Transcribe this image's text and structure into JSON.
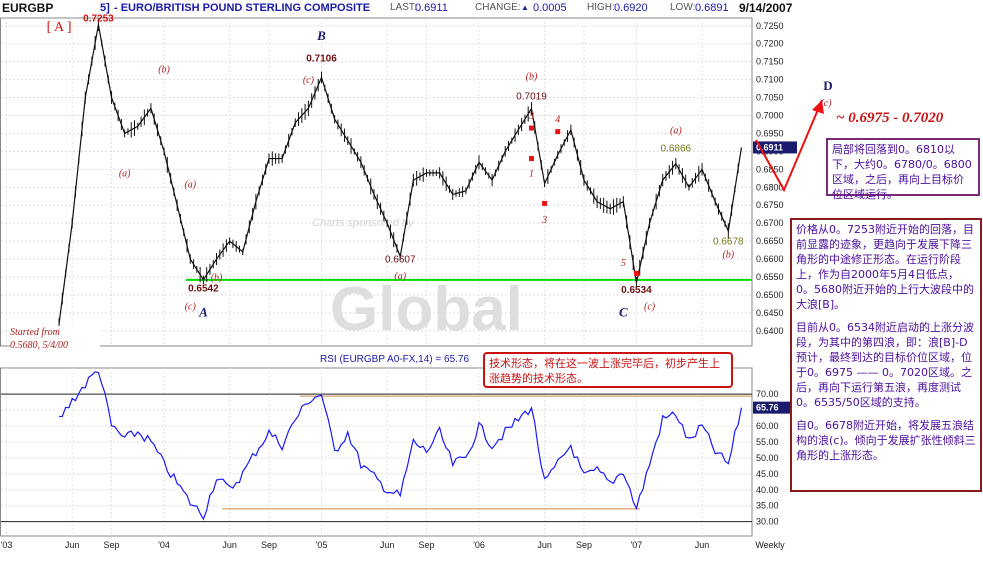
{
  "header": {
    "symbol": "EURGBP",
    "period_hint": "5]",
    "title": "- EURO/BRITISH POUND STERLING COMPOSITE",
    "last_label": "LAST:",
    "last_value": "0.6911",
    "change_label": "CHANGE:",
    "change_value": "0.0005",
    "high_label": "HIGH:",
    "high_value": "0.6920",
    "low_label": "LOW:",
    "low_value": "0.6891",
    "date": "9/14/2007"
  },
  "colors": {
    "price": "#111111",
    "support": "#00dd00",
    "rsi": "#1a1aff",
    "wave_label": "#b22222",
    "wave_letter": "#1a1a6e",
    "header_blue": "#1a1aaa",
    "last_marker": "#1a1a6e",
    "annotation": "#4b0d9e"
  },
  "chart_data": [
    {
      "type": "line",
      "name": "price",
      "x": [
        "2003-05",
        "2003-06",
        "2003-07",
        "2003-08",
        "2003-09",
        "2003-10",
        "2003-11",
        "2003-12",
        "2004-01",
        "2004-02",
        "2004-03",
        "2004-04",
        "2004-05",
        "2004-06",
        "2004-07",
        "2004-08",
        "2004-09",
        "2004-10",
        "2004-11",
        "2004-12",
        "2005-01",
        "2005-02",
        "2005-03",
        "2005-04",
        "2005-05",
        "2005-06",
        "2005-07",
        "2005-08",
        "2005-09",
        "2005-10",
        "2005-11",
        "2005-12",
        "2006-01",
        "2006-02",
        "2006-03",
        "2006-04",
        "2006-05",
        "2006-06",
        "2006-07",
        "2006-08",
        "2006-09",
        "2006-10",
        "2006-11",
        "2006-12",
        "2007-01",
        "2007-02",
        "2007-03",
        "2007-04",
        "2007-05",
        "2007-06",
        "2007-07",
        "2007-08",
        "2007-09"
      ],
      "y": [
        0.642,
        0.67,
        0.705,
        0.7253,
        0.705,
        0.695,
        0.697,
        0.702,
        0.69,
        0.675,
        0.66,
        0.6542,
        0.66,
        0.665,
        0.662,
        0.676,
        0.688,
        0.688,
        0.698,
        0.702,
        0.7106,
        0.699,
        0.693,
        0.687,
        0.678,
        0.67,
        0.6607,
        0.682,
        0.684,
        0.684,
        0.678,
        0.679,
        0.687,
        0.682,
        0.69,
        0.696,
        0.7019,
        0.681,
        0.689,
        0.696,
        0.682,
        0.676,
        0.674,
        0.676,
        0.6534,
        0.67,
        0.682,
        0.6866,
        0.68,
        0.685,
        0.676,
        0.6678,
        0.6911
      ],
      "tick_labels_x": [
        "'03",
        "Jun",
        "Sep",
        "'04",
        "Jun",
        "Sep",
        "'05",
        "Jun",
        "Sep",
        "'06",
        "Jun",
        "Sep",
        "'07",
        "Jun",
        "Weekly"
      ],
      "tick_labels_y": [
        "0.7250",
        "0.7200",
        "0.7150",
        "0.7100",
        "0.7050",
        "0.7000",
        "0.6950",
        "0.6900",
        "0.6850",
        "0.6800",
        "0.6750",
        "0.6700",
        "0.6650",
        "0.6600",
        "0.6550",
        "0.6500",
        "0.6450",
        "0.6400"
      ],
      "ylim": [
        0.638,
        0.728
      ],
      "support_level": 0.6542,
      "last_value": "0.6911",
      "watermark_text": "Charts sponsored by",
      "watermark_brand": "Global",
      "wave_labels": [
        {
          "text": "[ A ]",
          "date": "2003-05",
          "value": 0.7235
        },
        {
          "text": "0.7253",
          "date": "2003-08",
          "value": 0.7262
        },
        {
          "text": "(b)",
          "date": "2004-01",
          "value": 0.712
        },
        {
          "text": "(a)",
          "date": "2003-10",
          "value": 0.683
        },
        {
          "text": "(a)",
          "date": "2004-03",
          "value": 0.68
        },
        {
          "text": "(b)",
          "date": "2004-05",
          "value": 0.654
        },
        {
          "text": "0.6542",
          "date": "2004-04",
          "value": 0.651
        },
        {
          "text": "(c)",
          "date": "2004-03",
          "value": 0.646
        },
        {
          "text": "A",
          "date": "2004-04",
          "value": 0.644
        },
        {
          "text": "B",
          "date": "2005-01",
          "value": 0.721
        },
        {
          "text": "0.7106",
          "date": "2005-01",
          "value": 0.715
        },
        {
          "text": "(c)",
          "date": "2004-12",
          "value": 0.709
        },
        {
          "text": "0.6607",
          "date": "2005-07",
          "value": 0.659
        },
        {
          "text": "(a)",
          "date": "2005-07",
          "value": 0.6545
        },
        {
          "text": "(b)",
          "date": "2006-05",
          "value": 0.71
        },
        {
          "text": "0.7019",
          "date": "2006-05",
          "value": 0.7045
        },
        {
          "text": "3",
          "date": "2006-05",
          "value": 0.699
        },
        {
          "text": "4",
          "date": "2006-07",
          "value": 0.698
        },
        {
          "text": "1",
          "date": "2006-05",
          "value": 0.683
        },
        {
          "text": "3",
          "date": "2006-06",
          "value": 0.67
        },
        {
          "text": "5",
          "date": "2006-12",
          "value": 0.658
        },
        {
          "text": "0.6534",
          "date": "2007-01",
          "value": 0.6505
        },
        {
          "text": "(c)",
          "date": "2007-02",
          "value": 0.646
        },
        {
          "text": "C",
          "date": "2006-12",
          "value": 0.644
        },
        {
          "text": "(a)",
          "date": "2007-04",
          "value": 0.695
        },
        {
          "text": "0.6866",
          "date": "2007-04",
          "value": 0.69
        },
        {
          "text": "0.6678",
          "date": "2007-08",
          "value": 0.664
        },
        {
          "text": "(b)",
          "date": "2007-08",
          "value": 0.6605
        }
      ],
      "wave_markers": [
        {
          "date": "2006-05",
          "value": 0.6965
        },
        {
          "date": "2006-07",
          "value": 0.6955
        },
        {
          "date": "2006-05",
          "value": 0.688
        },
        {
          "date": "2006-06",
          "value": 0.6755
        },
        {
          "date": "2007-01",
          "value": 0.656
        }
      ]
    },
    {
      "type": "line",
      "name": "rsi",
      "title": "RSI (EURGBP A0-FX,14) = 65.76",
      "x": [
        "2003-05",
        "2003-06",
        "2003-07",
        "2003-08",
        "2003-09",
        "2003-10",
        "2003-11",
        "2003-12",
        "2004-01",
        "2004-02",
        "2004-03",
        "2004-04",
        "2004-05",
        "2004-06",
        "2004-07",
        "2004-08",
        "2004-09",
        "2004-10",
        "2004-11",
        "2004-12",
        "2005-01",
        "2005-02",
        "2005-03",
        "2005-04",
        "2005-05",
        "2005-06",
        "2005-07",
        "2005-08",
        "2005-09",
        "2005-10",
        "2005-11",
        "2005-12",
        "2006-01",
        "2006-02",
        "2006-03",
        "2006-04",
        "2006-05",
        "2006-06",
        "2006-07",
        "2006-08",
        "2006-09",
        "2006-10",
        "2006-11",
        "2006-12",
        "2007-01",
        "2007-02",
        "2007-03",
        "2007-04",
        "2007-05",
        "2007-06",
        "2007-07",
        "2007-08",
        "2007-09"
      ],
      "y": [
        62,
        68,
        73,
        78,
        60,
        56,
        58,
        55,
        48,
        42,
        36,
        32,
        44,
        40,
        45,
        52,
        58,
        54,
        62,
        68,
        70,
        52,
        58,
        48,
        44,
        40,
        38,
        55,
        52,
        58,
        48,
        50,
        60,
        54,
        58,
        62,
        66,
        42,
        48,
        54,
        44,
        46,
        42,
        46,
        34,
        48,
        62,
        64,
        55,
        60,
        52,
        48,
        65.76
      ],
      "tick_labels_y": [
        "70.00",
        "65.00",
        "60.00",
        "55.00",
        "50.00",
        "45.00",
        "40.00",
        "35.00",
        "30.00"
      ],
      "ylim": [
        28,
        76
      ],
      "overbought": 70,
      "oversold": 30,
      "trend_low": 34,
      "last_value": "65.76"
    }
  ],
  "annotations": {
    "start_line1": "Started from",
    "start_line2": "0.5680,  5/4/00",
    "target_letter": "D",
    "target_wave": "(c)",
    "target_range": "~ 0.6975 - 0.7020",
    "note_d": "局部将回落到0。6810以下，大约0。6780/0。6800区域，之后，再向上目标价位区域运行。",
    "note_tech": "技术形态，将在这一波上涨完毕后，初步产生上涨趋势的技术形态。",
    "note_main_p1": "价格从0。7253附近开始的回落，目前显露的迹象，更趋向于发展下降三角形的中途修正形态。在运行阶段上，作为自2000年5月4日低点，0。5680附近开始的上行大波段中的大浪[B]。",
    "note_main_p2": "目前从0。6534附近启动的上涨分波段，为其中的第四浪，即：浪[B]-D",
    "note_main_p3": "预计，最终到达的目标价位区域，位于0。6975 —— 0。7020区域。之后，再向下运行第五浪，再度测试0。6535/50区域的支持。",
    "note_main_p4": "自0。6678附近开始，将发展五浪结构的浪(c)。倾向于发展扩张性倾斜三角形的上涨形态。"
  }
}
